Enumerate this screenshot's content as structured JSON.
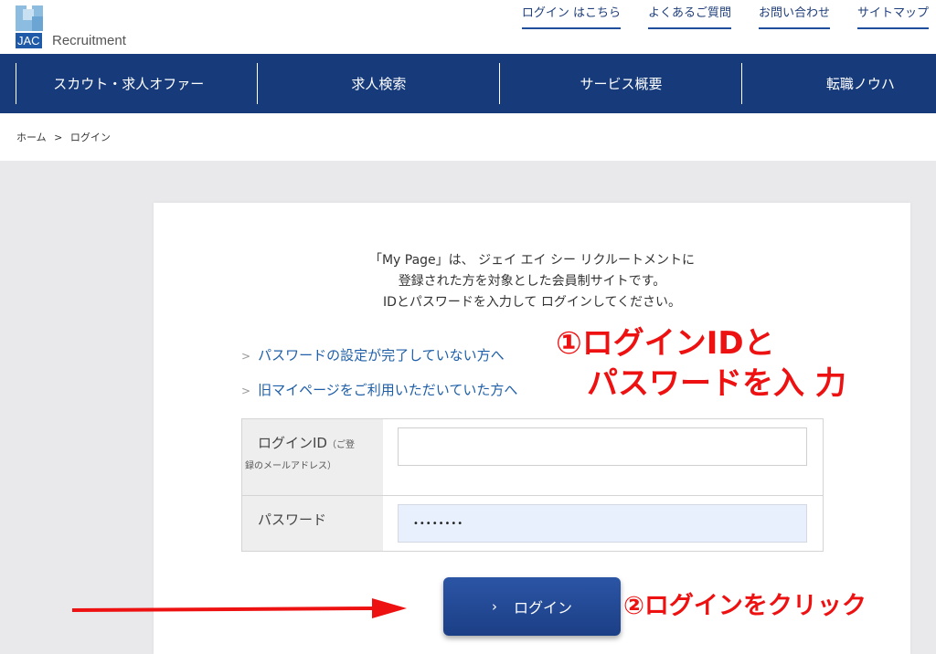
{
  "brand": {
    "logo_box": "JAC",
    "logo_text": "Recruitment",
    "mark_color": "#7fb3d9",
    "accent": "#1e5aa8"
  },
  "top_links": [
    {
      "label": "ログイン はこちら"
    },
    {
      "label": "よくあるご質問"
    },
    {
      "label": "お問い合わせ"
    },
    {
      "label": "サイトマップ"
    }
  ],
  "nav": {
    "background": "#173b7a",
    "items": [
      {
        "label": "スカウト・求人オファー"
      },
      {
        "label": "求人検索"
      },
      {
        "label": "サービス概要"
      },
      {
        "label": "転職ノウハ"
      }
    ]
  },
  "breadcrumb": {
    "home": "ホーム",
    "separator": ">",
    "current": "ログイン"
  },
  "intro": {
    "line1": "「My Page」は、 ジェイ エイ シー リクルートメントに",
    "line2": "登録された方を対象とした会員制サイトです。",
    "line3": "IDとパスワードを入力して ログインしてください。"
  },
  "links": [
    {
      "label": "パスワードの設定が完了していない方へ"
    },
    {
      "label": "旧マイページをご利用いただいていた方へ"
    }
  ],
  "form": {
    "login_id": {
      "label": "ログインID",
      "label_note_1": "（ご登",
      "label_note_2": "録のメールアドレス）",
      "value": "",
      "placeholder": ""
    },
    "password": {
      "label": "パスワード",
      "value": "••••••••"
    }
  },
  "login_button": {
    "chevron": "›",
    "label": "ログイン"
  },
  "annotations": {
    "step1_line1": "①ログインIDと",
    "step1_line2": "パスワードを入 力",
    "step2": "②ログインをクリック",
    "color": "#ee1111"
  }
}
